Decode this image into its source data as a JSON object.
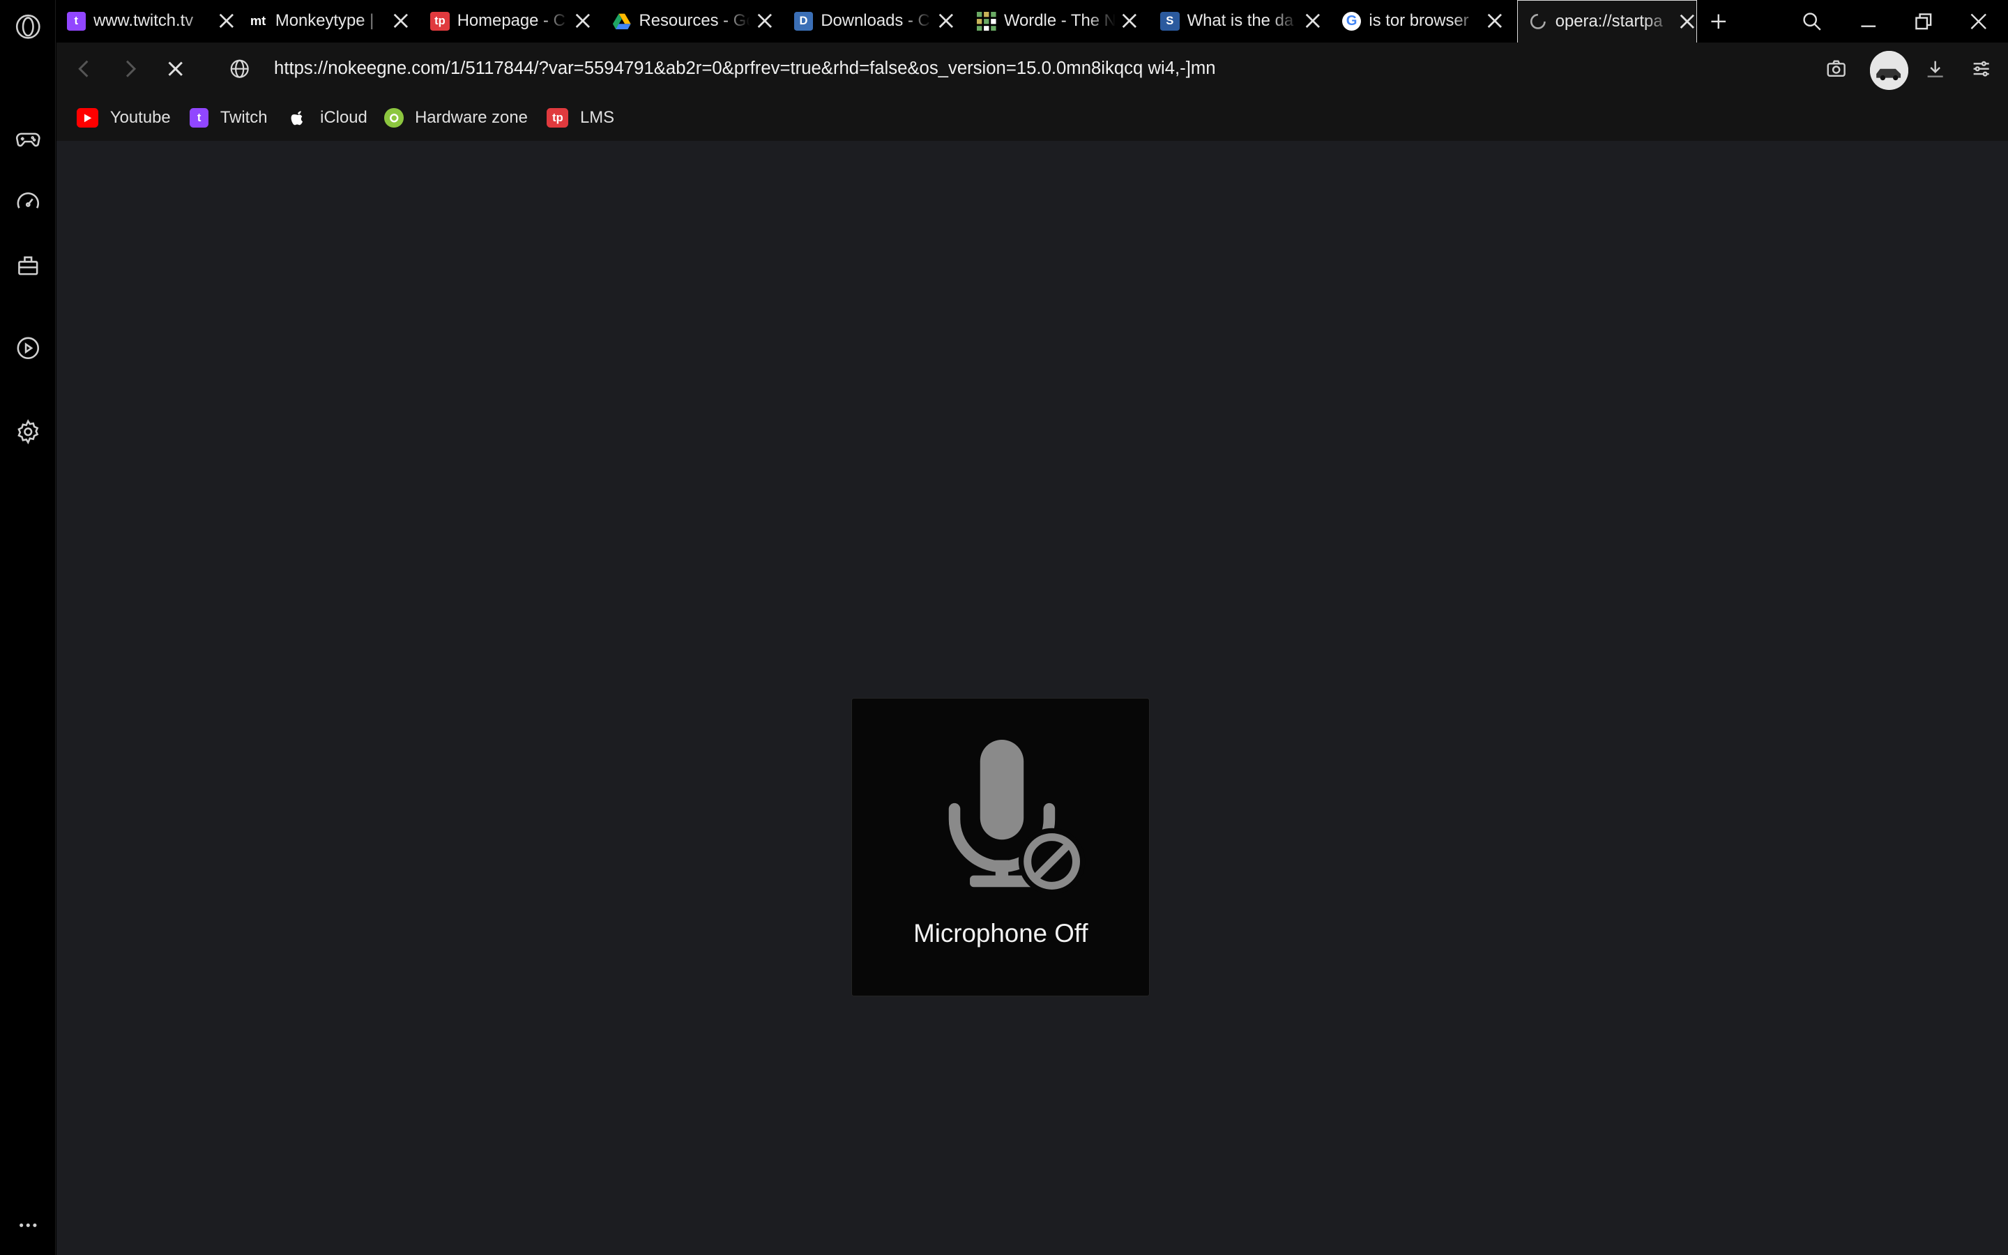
{
  "browser": {
    "tabs": [
      {
        "title": "www.twitch.tv",
        "icon": "twitch-icon",
        "color": "#9146ff",
        "glyph": "t"
      },
      {
        "title": "Monkeytype | ",
        "icon": "monkeytype-icon",
        "color": "#000000",
        "glyph": "mt"
      },
      {
        "title": "Homepage - C",
        "icon": "tp-icon",
        "color": "#e03a3e",
        "glyph": "tp"
      },
      {
        "title": "Resources - Go",
        "icon": "google-drive-icon",
        "color": "#1fa463",
        "glyph": ""
      },
      {
        "title": "Downloads - C",
        "icon": "downloads-icon",
        "color": "#3b6fb6",
        "glyph": "D"
      },
      {
        "title": "Wordle - The N",
        "icon": "wordle-icon",
        "color": "#6aaa64",
        "glyph": ""
      },
      {
        "title": "What is the da",
        "icon": "stackexchange-icon",
        "color": "#2b5a9e",
        "glyph": "S"
      },
      {
        "title": "is tor browser",
        "icon": "google-icon",
        "color": "#ffffff",
        "glyph": "G"
      },
      {
        "title": "opera://startpa",
        "icon": "loading-spinner-icon",
        "color": "#999999",
        "glyph": ""
      }
    ],
    "address": {
      "url": "https://nokeegne.com/1/5117844/?var=5594791&ab2r=0&prfrev=true&rhd=false&os_version=15.0.0mn8ikqcq wi4,-]mn"
    },
    "bookmarks": [
      {
        "label": "Youtube",
        "icon": "youtube-icon",
        "color": "#ff0000"
      },
      {
        "label": "Twitch",
        "icon": "twitch-icon",
        "color": "#9146ff"
      },
      {
        "label": "iCloud",
        "icon": "apple-icon",
        "color": "#ffffff"
      },
      {
        "label": "Hardware zone",
        "icon": "hardwarezone-icon",
        "color": "#8cc63f"
      },
      {
        "label": "LMS",
        "icon": "tp-icon",
        "color": "#e03a3e"
      }
    ],
    "sidebar_icons": [
      "opera-logo-icon",
      "gamepad-icon",
      "speed-dial-icon",
      "extensions-icon",
      "player-icon",
      "settings-icon",
      "more-icon"
    ]
  },
  "page": {
    "mic_status": "Microphone Off"
  }
}
